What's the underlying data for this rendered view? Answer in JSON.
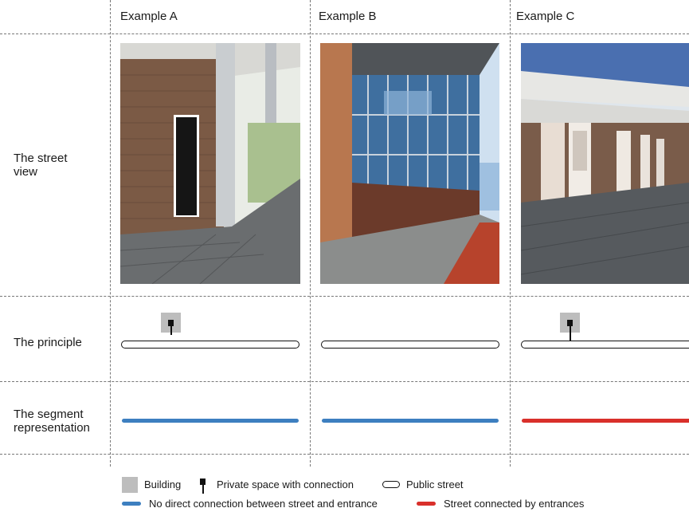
{
  "columns": {
    "a": "Example A",
    "b": "Example B",
    "c": "Example C"
  },
  "rows": {
    "street_view": "The street view",
    "principle": "The principle",
    "segment": "The segment representation"
  },
  "legend": {
    "building": "Building",
    "private_space": "Private space with connection",
    "public_street": "Public street",
    "no_connection": "No direct connection between street and entrance",
    "connected": "Street connected by entrances"
  },
  "colors": {
    "no_connection": "#3d7fc0",
    "connected": "#d9302b",
    "building": "#bdbdbd"
  }
}
